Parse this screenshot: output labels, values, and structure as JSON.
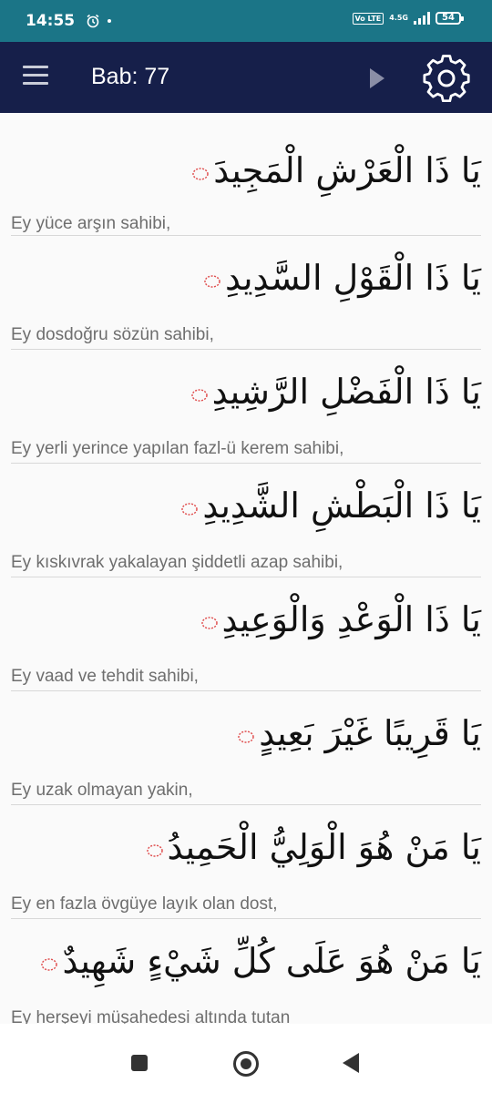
{
  "status_bar": {
    "time": "14:55",
    "volte": "Vo LTE",
    "network": "4.5G",
    "battery": "54"
  },
  "app_bar": {
    "title": "Bab: 77"
  },
  "entries": [
    {
      "arabic": "يَا ذَا الْعَرْشِ الْمَجِيدَ",
      "translation": "Ey yüce arşın sahibi,"
    },
    {
      "arabic": "يَا ذَا الْقَوْلِ السَّدِيدِ",
      "translation": "Ey dosdoğru sözün sahibi,"
    },
    {
      "arabic": "يَا ذَا الْفَضْلِ الرَّشِيدِ",
      "translation": "Ey yerli yerince yapılan fazl-ü kerem sahibi,"
    },
    {
      "arabic": "يَا ذَا الْبَطْشِ الشَّدِيدِ",
      "translation": "Ey kıskıvrak yakalayan şiddetli azap sahibi,"
    },
    {
      "arabic": "يَا ذَا الْوَعْدِ وَالْوَعِيدِ",
      "translation": "Ey vaad ve tehdit sahibi,"
    },
    {
      "arabic": "يَا قَرِيبًا غَيْرَ بَعِيدٍ",
      "translation": "Ey uzak olmayan yakin,"
    },
    {
      "arabic": "يَا مَنْ هُوَ الْوَلِيُّ الْحَمِيدُ",
      "translation": "Ey en fazla övgüye layık olan dost,"
    },
    {
      "arabic": "يَا مَنْ هُوَ عَلَى كُلِّ شَيْءٍ شَهِيدٌ",
      "translation": "Ey herşeyi müşahedesi altında tutan"
    }
  ],
  "colors": {
    "status_bar": "#1b7587",
    "app_bar": "#161f4a",
    "ayah_marker": "#e05050"
  },
  "icons": {
    "menu": "hamburger-menu-icon",
    "next": "play-arrow-icon",
    "settings": "gear-icon"
  }
}
